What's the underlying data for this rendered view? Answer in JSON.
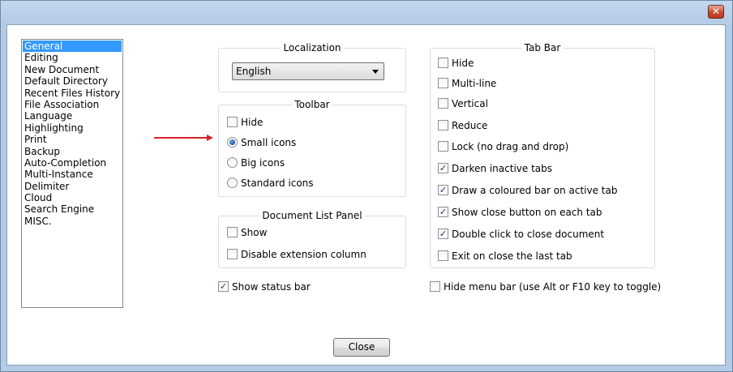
{
  "window": {
    "close_glyph": "✕"
  },
  "nav": {
    "items": [
      "General",
      "Editing",
      "New Document",
      "Default Directory",
      "Recent Files History",
      "File Association",
      "Language",
      "Highlighting",
      "Print",
      "Backup",
      "Auto-Completion",
      "Multi-Instance",
      "Delimiter",
      "Cloud",
      "Search Engine",
      "MISC."
    ],
    "selected": "General"
  },
  "localization": {
    "title": "Localization",
    "language_value": "English"
  },
  "toolbar": {
    "title": "Toolbar",
    "hide_label": "Hide",
    "hide_checked": false,
    "options": [
      "Small icons",
      "Big icons",
      "Standard icons"
    ],
    "selected": "Small icons"
  },
  "doclist": {
    "title": "Document List Panel",
    "show_label": "Show",
    "show_checked": false,
    "disable_ext_label": "Disable extension column",
    "disable_ext_checked": false
  },
  "status_bar": {
    "label": "Show status bar",
    "checked": true
  },
  "tabbar": {
    "title": "Tab Bar",
    "items": [
      {
        "label": "Hide",
        "checked": false
      },
      {
        "label": "Multi-line",
        "checked": false
      },
      {
        "label": "Vertical",
        "checked": false
      },
      {
        "label": "Reduce",
        "checked": false
      },
      {
        "label": "Lock (no drag and drop)",
        "checked": false
      },
      {
        "label": "Darken inactive tabs",
        "checked": true
      },
      {
        "label": "Draw a coloured bar on active tab",
        "checked": true
      },
      {
        "label": "Show close button on each tab",
        "checked": true
      },
      {
        "label": "Double click to close document",
        "checked": true
      },
      {
        "label": "Exit on close the last tab",
        "checked": false
      }
    ]
  },
  "menu_bar": {
    "label": "Hide menu bar (use Alt or F10 key to toggle)",
    "checked": false
  },
  "footer": {
    "close_label": "Close"
  },
  "colors": {
    "selection": "#3399ff",
    "annotation_arrow": "#d6232a",
    "frame": "#b4cbe6"
  },
  "icons": {
    "window_close": "close-icon",
    "dropdown": "chevron-down-icon",
    "annotation": "arrow-right-icon"
  }
}
